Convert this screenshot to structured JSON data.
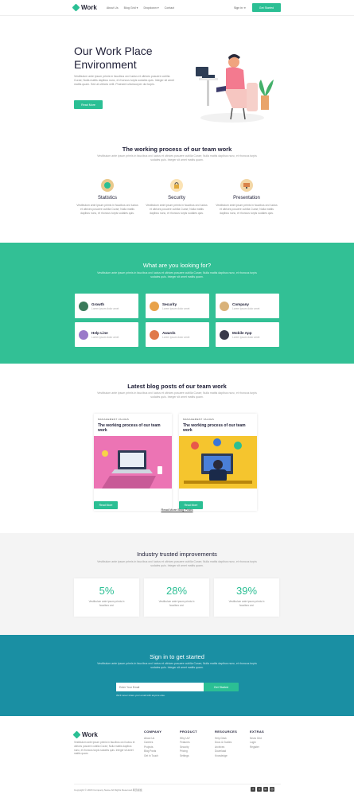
{
  "nav": {
    "brand": "Work",
    "links": [
      "About Us",
      "Blog Grid ▾",
      "Dropdown ▾",
      "Contact"
    ],
    "sign_in": "Sign in",
    "cta": "Get Started"
  },
  "hero": {
    "title_line1": "Our Work Place",
    "title_line2": "Environment",
    "description": "Vestibulum ante ipsum primis in faucibus orci luctus et ultrices posuere cubilia Curae; Nulla mattis dapibus nunc, et rhoncus turpis sodales quis. Integer sit amet mattis quam. Sed at ultrices velit. Praesent ullamcorper dui turpis.",
    "button": "Read More"
  },
  "process": {
    "title": "The working process of our team work",
    "subtitle": "Vestibulum ante ipsum primis in faucibus orci luctus et ultrices posuere cubilia Curae; Nulla mattis dapibus nunc, et rhoncus turpis sodales quis. Integer sit amet mattis quam.",
    "features": [
      {
        "title": "Statistics",
        "desc": "Vestibulum ante ipsum primis in faucibus orci luctus et ultrices posuere cubilia Curae; Nulla mattis dapibus nunc, et rhoncus turpis sodales quis."
      },
      {
        "title": "Security",
        "desc": "Vestibulum ante ipsum primis in faucibus orci luctus et ultrices posuere cubilia Curae; Nulla mattis dapibus nunc, et rhoncus turpis sodales quis."
      },
      {
        "title": "Presentation",
        "desc": "Vestibulum ante ipsum primis in faucibus orci luctus et ultrices posuere cubilia Curae; Nulla mattis dapibus nunc, et rhoncus turpis sodales quis."
      }
    ]
  },
  "looking": {
    "title": "What are you looking for?",
    "subtitle": "Vestibulum ante ipsum primis in faucibus orci luctus et ultrices posuere cubilia Curae; Nulla mattis dapibus nunc, et rhoncus turpis sodales quis. Integer sit amet mattis quam.",
    "cards": [
      {
        "title": "Growth",
        "sub": "Lorem ipsum dolor amet"
      },
      {
        "title": "Security",
        "sub": "Lorem ipsum dolor amet"
      },
      {
        "title": "Company",
        "sub": "Lorem ipsum dolor amet"
      },
      {
        "title": "Help Line",
        "sub": "Lorem ipsum dolor amet"
      },
      {
        "title": "Awards",
        "sub": "Lorem ipsum dolor amet"
      },
      {
        "title": "Mobile App",
        "sub": "Lorem ipsum dolor amet"
      }
    ]
  },
  "blog": {
    "title": "Latest blog posts of our team work",
    "subtitle": "Vestibulum ante ipsum primis in faucibus orci luctus et ultrices posuere cubilia Curae; Nulla mattis dapibus nunc, et rhoncus turpis sodales quis. Integer sit amet mattis quam.",
    "posts": [
      {
        "category": "MANAGEMENT VALUES",
        "title": "The working process of our team work",
        "button": "Read More"
      },
      {
        "category": "MANAGEMENT VALUES",
        "title": "The working process of our team work",
        "button": "Read More"
      }
    ],
    "read_more": "Read More Blog Posts"
  },
  "industry": {
    "title": "Industry trusted improvements",
    "subtitle": "Vestibulum ante ipsum primis in faucibus orci luctus et ultrices posuere cubilia Curae; Nulla mattis dapibus nunc, et rhoncus turpis sodales quis. Integer sit amet mattis quam.",
    "stats": [
      {
        "value": "5%",
        "desc": "Vestibulum ante ipsum primis in faucibus orci"
      },
      {
        "value": "28%",
        "desc": "Vestibulum ante ipsum primis in faucibus orci"
      },
      {
        "value": "39%",
        "desc": "Vestibulum ante ipsum primis in faucibus orci"
      }
    ]
  },
  "signin": {
    "title": "Sign in to get started",
    "subtitle": "Vestibulum ante ipsum primis in faucibus orci luctus et ultrices posuere cubilia Curae; Nulla mattis dapibus nunc, et rhoncus turpis sodales quis. Integer sit amet mattis quam.",
    "email_placeholder": "Enter Your Email",
    "button": "Get Started",
    "note": "We'll never share your email with anyone else."
  },
  "footer": {
    "brand": "Work",
    "description": "Vestibulum ante ipsum primis in faucibus orci luctus et ultrices posuere cubilia Curae; Nulla mattis dapibus nunc, et rhoncus turpis sodales quis. Integer sit amet mattis quam.",
    "columns": [
      {
        "heading": "COMPANY",
        "items": [
          "About Us",
          "Careers",
          "Projects",
          "Blog Posts",
          "Get in Touch"
        ]
      },
      {
        "heading": "PRODUCT",
        "items": [
          "Why Us?",
          "Features",
          "Security",
          "Pricing",
          "Settings"
        ]
      },
      {
        "heading": "RESOURCES",
        "items": [
          "Help Desk",
          "Docs & Guides",
          "Archives",
          "Download",
          "Knowledge"
        ]
      },
      {
        "heading": "EXTRAS",
        "items": [
          "News Grid",
          "Login",
          "Register"
        ]
      }
    ],
    "copyright": "Copyright © 2018 Company Name All Rights Reserved.网页模板"
  },
  "colors": {
    "accent": "#2bbf94",
    "band": "#32c095",
    "signin": "#1a8fa3",
    "dark": "#22223a"
  }
}
